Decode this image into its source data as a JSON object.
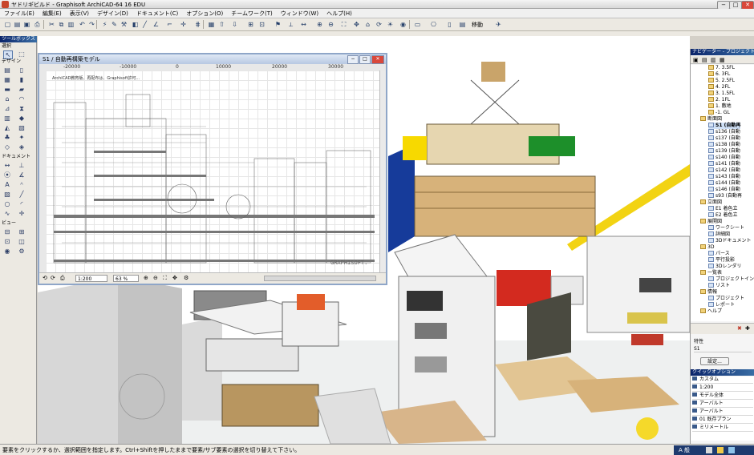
{
  "title_bar": {
    "text": "ヤドリギビルド - Graphisoft ArchiCAD-64 16 EDU"
  },
  "menu": [
    "ファイル(E)",
    "編集(E)",
    "表示(V)",
    "デザイン(D)",
    "ドキュメント(C)",
    "オプション(O)",
    "チームワーク(T)",
    "ウィンドウ(W)",
    "ヘルプ(H)"
  ],
  "toolbar": {
    "move_label": "移動"
  },
  "toolbox": {
    "title": "ツールボックス",
    "select_label": "選択",
    "design_label": "デザイン",
    "document_label": "ドキュメント",
    "view_label": "ビュー"
  },
  "section_window": {
    "title": "S1 / 自動再構築モデル",
    "ruler_labels": [
      "-20000",
      "-10000",
      "0",
      "10000",
      "20000",
      "30000"
    ],
    "note": "ArchiCAD教育版、再配布は、Graphisoft許可...",
    "scale": "1:200",
    "zoom": "63 %",
    "watermark": "GRAPHISOFT."
  },
  "navigator": {
    "title": "ナビゲーター - プロジェクトー覧",
    "items": [
      {
        "label": "7. 3.5FL",
        "icon": "story"
      },
      {
        "label": "6. 3FL",
        "icon": "story"
      },
      {
        "label": "5. 2.5FL",
        "icon": "story"
      },
      {
        "label": "4. 2FL",
        "icon": "story"
      },
      {
        "label": "3. 1.5FL",
        "icon": "story"
      },
      {
        "label": "2. 1FL",
        "icon": "story"
      },
      {
        "label": "1. 敷地",
        "icon": "story"
      },
      {
        "label": "-1. GL",
        "icon": "story"
      },
      {
        "label": "断面図",
        "icon": "folder"
      },
      {
        "label": "S1 (自動再",
        "icon": "section",
        "selected": true
      },
      {
        "label": "s136 (自動",
        "icon": "section"
      },
      {
        "label": "s137 (自動",
        "icon": "section"
      },
      {
        "label": "s138 (自動",
        "icon": "section"
      },
      {
        "label": "s139 (自動",
        "icon": "section"
      },
      {
        "label": "s140 (自動",
        "icon": "section"
      },
      {
        "label": "s141 (自動",
        "icon": "section"
      },
      {
        "label": "s142 (自動",
        "icon": "section"
      },
      {
        "label": "s143 (自動",
        "icon": "section"
      },
      {
        "label": "s144 (自動",
        "icon": "section"
      },
      {
        "label": "s146 (自動",
        "icon": "section"
      },
      {
        "label": "s93 (自動再",
        "icon": "section"
      },
      {
        "label": "立面図",
        "icon": "folder"
      },
      {
        "label": "E1 着色立",
        "icon": "section"
      },
      {
        "label": "E2 着色立",
        "icon": "section"
      },
      {
        "label": "展開図",
        "icon": "folder"
      },
      {
        "label": "ワークシート",
        "icon": "doc"
      },
      {
        "label": "詳細図",
        "icon": "doc"
      },
      {
        "label": "3Dドキュメント",
        "icon": "doc"
      },
      {
        "label": "3D",
        "icon": "folder"
      },
      {
        "label": "パース",
        "icon": "doc"
      },
      {
        "label": "平行投影",
        "icon": "doc"
      },
      {
        "label": "3Dレンダリ",
        "icon": "doc"
      },
      {
        "label": "一覧表",
        "icon": "folder"
      },
      {
        "label": "プロジェクトイン",
        "icon": "doc"
      },
      {
        "label": "リスト",
        "icon": "doc"
      },
      {
        "label": "情報",
        "icon": "folder"
      },
      {
        "label": "プロジェクト",
        "icon": "doc"
      },
      {
        "label": "レポート",
        "icon": "doc"
      },
      {
        "label": "ヘルプ",
        "icon": "folder"
      }
    ],
    "properties_label": "特性",
    "properties_value": "S1",
    "settings_button": "設定...",
    "quick_options_title": "クイックオプション",
    "quick_options": [
      "カスタム",
      "1:200",
      "モデル全体",
      "アーバルト",
      "アーバルト",
      "01 既存プラン",
      "ミリメートル"
    ]
  },
  "status_bar": {
    "message": "要素をクリックするか、選択範囲を指定します。Ctrl+Shiftを押したままで要素/サブ要素の選択を切り替えて下さい。",
    "clock": "A 般"
  },
  "colors": {
    "title_gradient": "#0a246a",
    "section_frame": "#8fa6c8",
    "accent_green": "#1d8f2a",
    "accent_red": "#d32a1f",
    "accent_yellow": "#f2d313"
  }
}
